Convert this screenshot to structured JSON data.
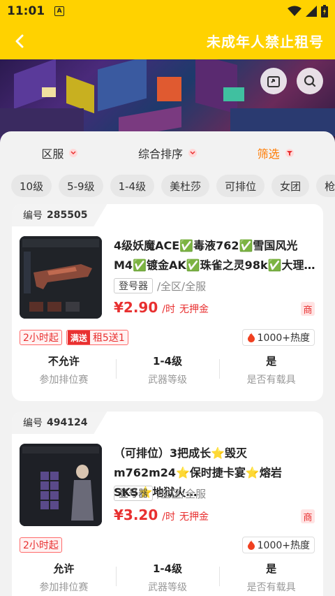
{
  "status_bar": {
    "time": "11:01",
    "notif_letter": "A"
  },
  "app_bar": {
    "title": "未成年人禁止租号"
  },
  "sort_bar": [
    {
      "label": "区服",
      "active": false
    },
    {
      "label": "综合排序",
      "active": false
    },
    {
      "label": "筛选",
      "active": true
    }
  ],
  "chips": [
    "10级",
    "5-9级",
    "1-4级",
    "美杜莎",
    "可排位",
    "女团",
    "枪"
  ],
  "listings": [
    {
      "id_label": "编号",
      "id": "285505",
      "title": "4级妖魔ACE✅毒液762✅雪国风光M4✅镀金AK✅珠雀之灵98k✅大理…",
      "login": "登号器",
      "region": "/全区/全服",
      "price": "¥2.90",
      "unit": "/时",
      "deposit": "无押金",
      "merchant": "商",
      "min_time": "2小时起",
      "promo_pill": "满送",
      "promo_text": "租5送1",
      "heat": "1000+热度",
      "stats": [
        {
          "value": "不允许",
          "label": "参加排位赛"
        },
        {
          "value": "1-4级",
          "label": "武器等级"
        },
        {
          "value": "是",
          "label": "是否有载具"
        }
      ]
    },
    {
      "id_label": "编号",
      "id": "494124",
      "title": "（可排位）3把成长⭐毁灭m762m24⭐保时捷卡宴⭐熔岩SKS⭐地狱火…",
      "login": "登号器",
      "region": "/全区/全服",
      "price": "¥3.20",
      "unit": "/时",
      "deposit": "无押金",
      "merchant": "商",
      "min_time": "2小时起",
      "heat": "1000+热度",
      "stats": [
        {
          "value": "允许",
          "label": "参加排位赛"
        },
        {
          "value": "1-4级",
          "label": "武器等级"
        },
        {
          "value": "是",
          "label": "是否有载具"
        }
      ]
    }
  ],
  "colors": {
    "brand_yellow": "#FFD200",
    "price_red": "#E83030",
    "filter_orange": "#FF7A00"
  }
}
